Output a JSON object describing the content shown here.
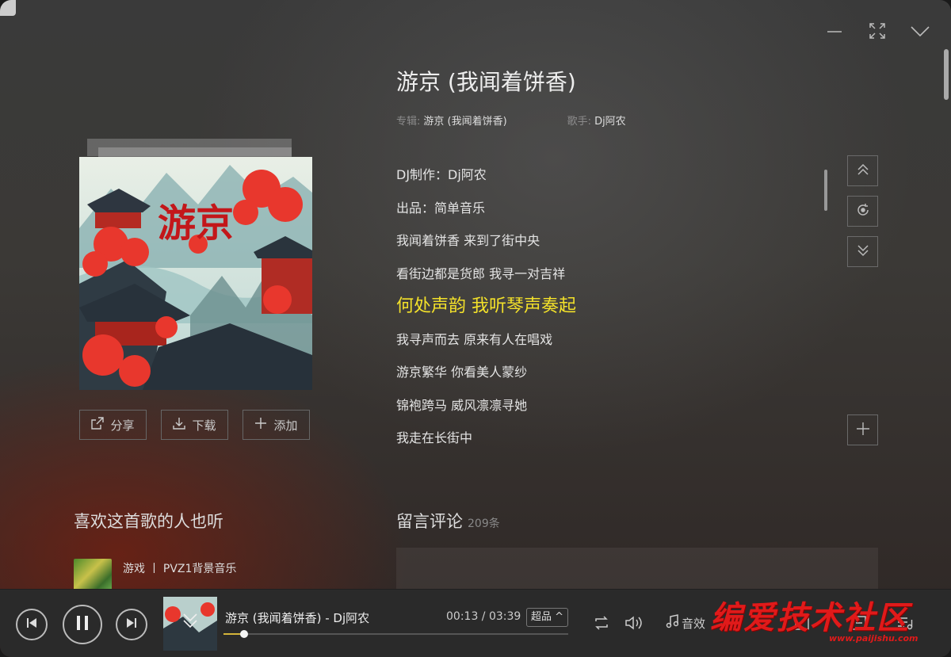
{
  "song": {
    "title": "游京 (我闻着饼香)",
    "album_label": "专辑:",
    "album": "游京 (我闻着饼香)",
    "artist_label": "歌手:",
    "artist": "Dj阿农"
  },
  "cover": {
    "calligraphy": "游京"
  },
  "actions": [
    {
      "label": "分享",
      "icon": "share-icon"
    },
    {
      "label": "下载",
      "icon": "download-icon"
    },
    {
      "label": "添加",
      "icon": "plus-icon"
    }
  ],
  "lyrics": {
    "lines": [
      "DJ制作：Dj阿农",
      "出品：简单音乐",
      "我闻着饼香 来到了街中央",
      "看街边都是货郎 我寻一对吉祥",
      "何处声韵 我听琴声奏起",
      "我寻声而去 原来有人在唱戏",
      "游京繁华 你看美人蒙纱",
      "锦袍跨马 威风凛凛寻她",
      "我走在长街中"
    ],
    "active_line": "何处声韵 我听琴声奏起",
    "active_color": "#f3e12a"
  },
  "similar": {
    "title": "喜欢这首歌的人也听",
    "items": [
      {
        "text": "游戏 丨 PVZ1背景音乐"
      }
    ]
  },
  "comments": {
    "title": "留言评论",
    "count": "209条"
  },
  "player": {
    "song": "游京 (我闻着饼香) - Dj阿农",
    "time": "00:13 / 03:39",
    "quality": "超品 ^",
    "effect": "音效",
    "progress": 0.0593,
    "accent": "#d4b43a"
  },
  "watermark": {
    "text": "编爱技术社区",
    "url": "www.paijishu.com"
  }
}
